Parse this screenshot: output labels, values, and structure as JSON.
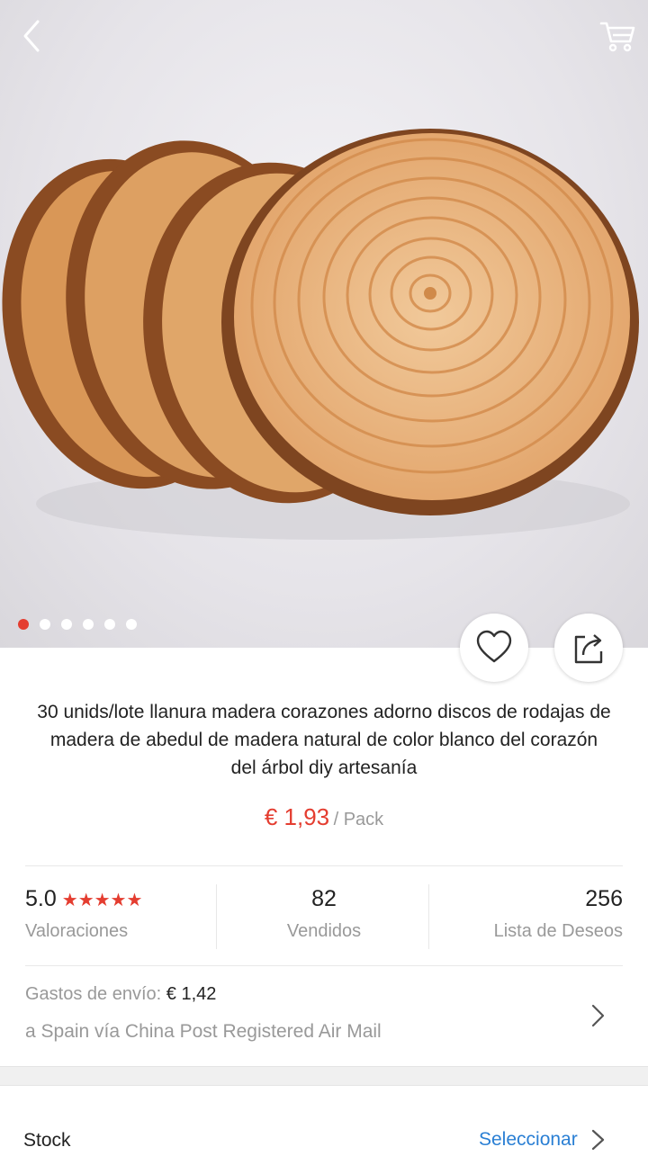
{
  "product": {
    "title": "30 unids/lote llanura madera corazones adorno discos de rodajas de madera de abedul de madera natural de color blanco del corazón del árbol diy artesanía",
    "price": "€ 1,93",
    "price_unit": "/ Pack"
  },
  "gallery": {
    "total_images": 6,
    "active_index": 0
  },
  "stats": {
    "rating_value": "5.0",
    "rating_stars": 5,
    "rating_label": "Valoraciones",
    "sold_value": "82",
    "sold_label": "Vendidos",
    "wishlist_value": "256",
    "wishlist_label": "Lista de Deseos"
  },
  "shipping": {
    "label": "Gastos de envío:",
    "value": "€ 1,42",
    "via": "a Spain vía China Post Registered Air Mail"
  },
  "stock": {
    "label": "Stock",
    "action": "Seleccionar"
  },
  "icons": {
    "back": "chevron-left-icon",
    "cart": "cart-icon",
    "wishlist": "heart-icon",
    "share": "share-icon"
  },
  "colors": {
    "accent": "#e43d30",
    "link": "#2a7fd4",
    "muted": "#999999"
  }
}
